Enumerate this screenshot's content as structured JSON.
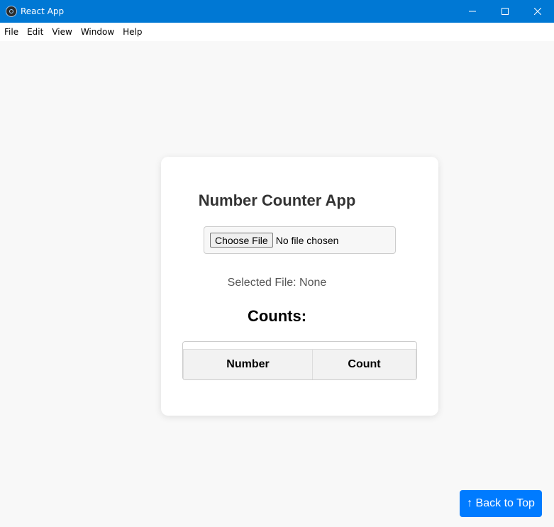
{
  "window": {
    "title": "React App",
    "minimize_icon": "minimize-icon",
    "maximize_icon": "maximize-icon",
    "close_icon": "close-icon"
  },
  "menu": {
    "items": [
      "File",
      "Edit",
      "View",
      "Window",
      "Help"
    ]
  },
  "app": {
    "title": "Number Counter App",
    "file_input": {
      "button_label": "Choose File",
      "status": "No file chosen"
    },
    "selected_file": "Selected File: None",
    "counts_heading": "Counts:",
    "table": {
      "columns": [
        "Number",
        "Count"
      ],
      "rows": []
    }
  },
  "back_to_top": {
    "label": "↑ Back to Top",
    "color": "#007bff"
  },
  "colors": {
    "titlebar": "#0078d4",
    "background": "#f8f8f8"
  }
}
